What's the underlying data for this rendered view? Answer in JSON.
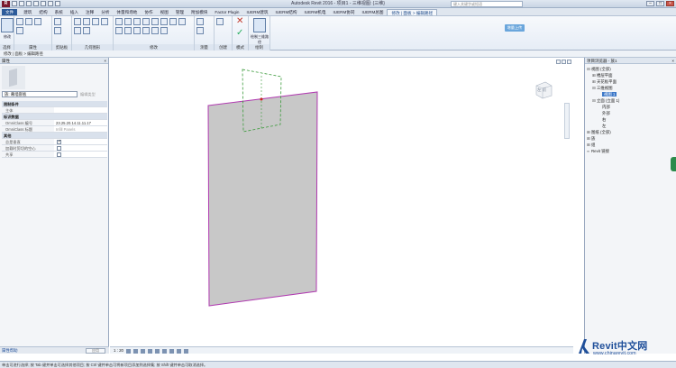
{
  "titlebar": {
    "logo": "R",
    "window_title": "Autodesk Revit 2016 - 项目1 - 三维视图: {三维}",
    "search_placeholder": "键入关键字或短语"
  },
  "tabs": [
    {
      "label": "文件"
    },
    {
      "label": "建筑"
    },
    {
      "label": "结构"
    },
    {
      "label": "系统"
    },
    {
      "label": "插入"
    },
    {
      "label": "注释"
    },
    {
      "label": "分析"
    },
    {
      "label": "体量和场地"
    },
    {
      "label": "协作"
    },
    {
      "label": "视图"
    },
    {
      "label": "管理"
    },
    {
      "label": "附加模块"
    },
    {
      "label": "Factor Plugin"
    },
    {
      "label": "IUERM建筑"
    },
    {
      "label": "IUERM结构"
    },
    {
      "label": "IUERM机电"
    },
    {
      "label": "IUERM协同"
    },
    {
      "label": "IUERM总图"
    },
    {
      "label": "修改 | 面板 > 编辑路径"
    }
  ],
  "ribbon": {
    "panels": [
      {
        "label": "选择"
      },
      {
        "label": "属性"
      },
      {
        "label": "剪贴板"
      },
      {
        "label": "几何图形"
      },
      {
        "label": "修改"
      },
      {
        "label": "测量"
      },
      {
        "label": "创建"
      },
      {
        "label": "模式"
      },
      {
        "label": "绘制"
      }
    ],
    "modify_label": "修改",
    "draw_3d_label": "绘制三维路径",
    "upload_label": "增量上传"
  },
  "options_bar": {
    "text": "修改 | 面板 > 编辑路径"
  },
  "properties": {
    "header": "属性",
    "type_name": "族: 幕墙嵌板",
    "edit_type": "编辑类型",
    "groups": [
      {
        "name": "限制条件",
        "rows": [
          {
            "key": "主体",
            "value": ""
          }
        ]
      },
      {
        "name": "标识数据",
        "rows": [
          {
            "key": "OmniClass 编号",
            "value": "23.25.20.14.11.11.17"
          },
          {
            "key": "OmniClass 标题",
            "value": "Infill Panels"
          }
        ]
      },
      {
        "name": "其他",
        "rows": [
          {
            "key": "总是垂直",
            "checked": true
          },
          {
            "key": "加载时剪切的空心",
            "checked": false
          },
          {
            "key": "共享",
            "checked": false
          }
        ]
      }
    ],
    "help_link": "属性帮助",
    "apply_label": "应用"
  },
  "canvas": {
    "viewcube_label": "左 前",
    "scale": "1 : 20"
  },
  "project_browser": {
    "header": "项目浏览器 - 族1",
    "tree": [
      {
        "label": "视图 (全部)",
        "level": 0,
        "exp": "⊟"
      },
      {
        "label": "楼层平面",
        "level": 1,
        "exp": "⊞"
      },
      {
        "label": "天花板平面",
        "level": 1,
        "exp": "⊞"
      },
      {
        "label": "三维视图",
        "level": 1,
        "exp": "⊟"
      },
      {
        "label": "视图 1",
        "level": 2,
        "exp": "",
        "selected": true
      },
      {
        "label": "立面 (立面 1)",
        "level": 1,
        "exp": "⊟"
      },
      {
        "label": "内部",
        "level": 2,
        "exp": ""
      },
      {
        "label": "外部",
        "level": 2,
        "exp": ""
      },
      {
        "label": "右",
        "level": 2,
        "exp": ""
      },
      {
        "label": "左",
        "level": 2,
        "exp": ""
      },
      {
        "label": "图纸 (全部)",
        "level": 0,
        "exp": "⊞"
      },
      {
        "label": "族",
        "level": 0,
        "exp": "⊞"
      },
      {
        "label": "组",
        "level": 0,
        "exp": "⊞"
      },
      {
        "label": "Revit 链接",
        "level": 0,
        "exp": "∞"
      }
    ]
  },
  "status_bar": {
    "text": "单击可进行选择; 按 Tab 键并单击可选择其他项目; 按 Ctrl 键并单击可将新项目添加到选择集; 按 Shift 键并单击可取消选择。"
  },
  "watermark": {
    "title": "Revit中文网",
    "url": "www.chinarevit.com"
  },
  "colors": {
    "panel_fill": "#c8c8c8",
    "panel_edge": "#b03ab0",
    "dashed_path": "#3a9a3a",
    "accent": "#1f4f9a"
  }
}
